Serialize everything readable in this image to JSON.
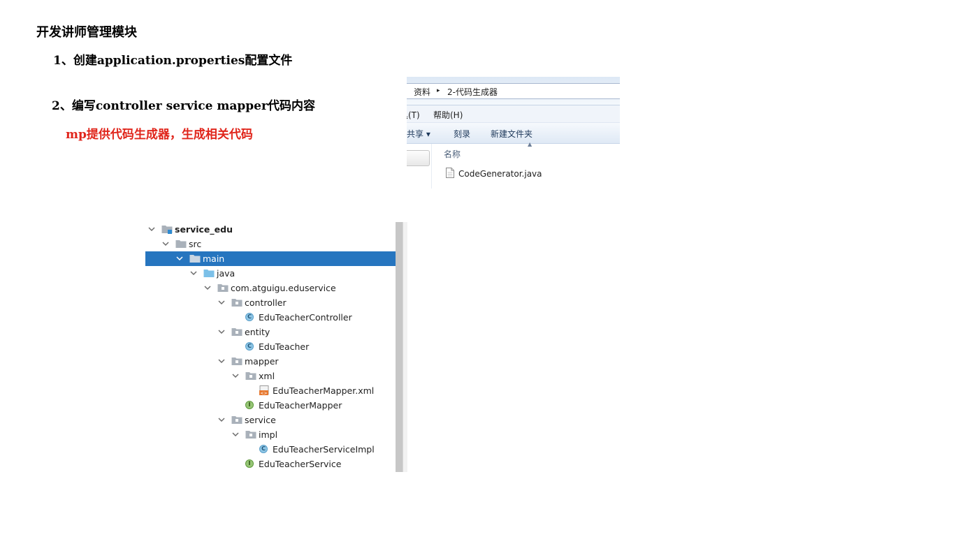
{
  "document": {
    "title": "开发讲师管理模块",
    "step1": "1、创建application.properties配置文件",
    "step2": "2、编写controller service mapper代码内容",
    "note": "mp提供代码生成器，生成相关代码"
  },
  "explorer": {
    "breadcrumb": [
      "资料",
      "2-代码生成器"
    ],
    "breadcrumb_sep": "▸",
    "menu": [
      "具(T)",
      "帮助(H)"
    ],
    "toolbar": [
      "共享 ▾",
      "刻录",
      "新建文件夹"
    ],
    "column_name": "名称",
    "file": "CodeGenerator.java"
  },
  "tree": {
    "items": [
      {
        "label": "service_edu",
        "depth": 0,
        "type": "module",
        "expanded": true,
        "bold": true
      },
      {
        "label": "src",
        "depth": 1,
        "type": "folder",
        "expanded": true
      },
      {
        "label": "main",
        "depth": 2,
        "type": "folder",
        "expanded": true,
        "selected": true
      },
      {
        "label": "java",
        "depth": 3,
        "type": "source-folder",
        "expanded": true
      },
      {
        "label": "com.atguigu.eduservice",
        "depth": 4,
        "type": "package",
        "expanded": true
      },
      {
        "label": "controller",
        "depth": 5,
        "type": "package",
        "expanded": true
      },
      {
        "label": "EduTeacherController",
        "depth": 6,
        "type": "class"
      },
      {
        "label": "entity",
        "depth": 5,
        "type": "package",
        "expanded": true
      },
      {
        "label": "EduTeacher",
        "depth": 6,
        "type": "class"
      },
      {
        "label": "mapper",
        "depth": 5,
        "type": "package",
        "expanded": true
      },
      {
        "label": "xml",
        "depth": 6,
        "type": "package",
        "expanded": true
      },
      {
        "label": "EduTeacherMapper.xml",
        "depth": 7,
        "type": "xml"
      },
      {
        "label": "EduTeacherMapper",
        "depth": 6,
        "type": "interface"
      },
      {
        "label": "service",
        "depth": 5,
        "type": "package",
        "expanded": true
      },
      {
        "label": "impl",
        "depth": 6,
        "type": "package",
        "expanded": true
      },
      {
        "label": "EduTeacherServiceImpl",
        "depth": 7,
        "type": "class"
      },
      {
        "label": "EduTeacherService",
        "depth": 6,
        "type": "interface"
      }
    ]
  }
}
